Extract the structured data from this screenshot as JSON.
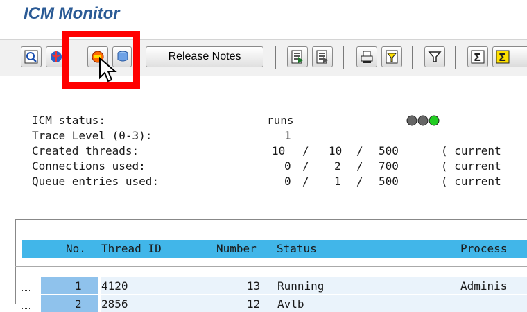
{
  "title": "ICM Monitor",
  "toolbar": {
    "release_notes_label": "Release Notes",
    "buttons": [
      "refresh-icon",
      "globe-icon",
      "stop-icon",
      "database-icon",
      "document-details-icon",
      "document-list-icon",
      "print-icon",
      "filter-list-icon",
      "filter-icon",
      "sum-icon",
      "subtotal-icon"
    ]
  },
  "status": {
    "rows": [
      {
        "label": "ICM status:",
        "value": "runs"
      },
      {
        "label": "Trace Level (0-3):",
        "value": "1"
      },
      {
        "label": "Created threads:",
        "a": "10",
        "b": "10",
        "c": "500",
        "note": "( current"
      },
      {
        "label": "Connections used:",
        "a": "0",
        "b": "2",
        "c": "700",
        "note": "( current"
      },
      {
        "label": "Queue entries used:",
        "a": "0",
        "b": "1",
        "c": "500",
        "note": "( current"
      }
    ],
    "light_colors": [
      "#666666",
      "#666666",
      "#22cc22"
    ]
  },
  "table": {
    "columns": [
      "No.",
      "Thread ID",
      "Number",
      "Status",
      "Process"
    ],
    "rows": [
      {
        "no": "1",
        "thread_id": "4120",
        "number": "13",
        "status": "Running",
        "process": "Adminis"
      },
      {
        "no": "2",
        "thread_id": "2856",
        "number": "12",
        "status": "Avlb",
        "process": ""
      }
    ]
  }
}
